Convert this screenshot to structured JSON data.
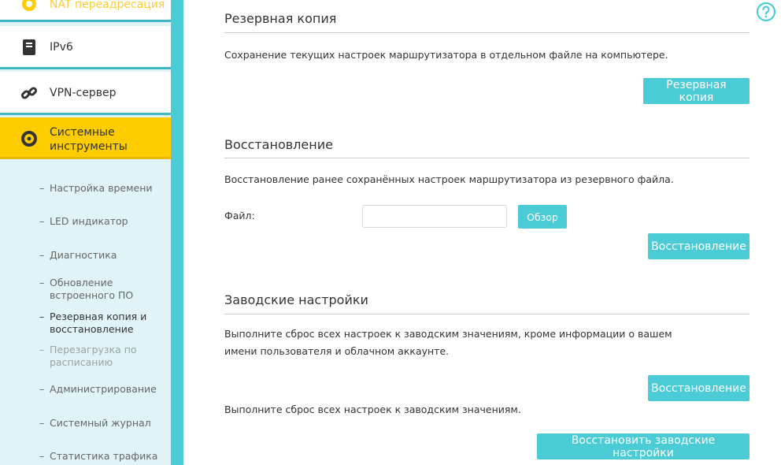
{
  "sidebar": {
    "items": [
      {
        "label": "NAT переадресация",
        "icon": "nat-icon"
      },
      {
        "label": "IPv6",
        "icon": "ipv6-icon"
      },
      {
        "label": "VPN-сервер",
        "icon": "link-icon"
      },
      {
        "label": "Системные\nинструменты",
        "icon": "gear-icon"
      }
    ],
    "sub_items": [
      "Настройка времени",
      "LED индикатор",
      "Диагностика",
      "Обновление\nвстроенного ПО",
      "Резервная копия и\nвосстановление",
      "Перезагрузка по\nрасписанию",
      "Администрирование",
      "Системный журнал",
      "Статистика трафика"
    ],
    "dash": "–"
  },
  "backup": {
    "title": "Резервная копия",
    "description": "Сохранение текущих настроек маршрутизатора в отдельном файле на компьютере.",
    "button": "Резервная копия"
  },
  "restore": {
    "title": "Восстановление",
    "description": "Восстановление ранее сохранённых настроек маршрутизатора из резервного файла.",
    "file_label": "Файл:",
    "file_value": "",
    "browse_button": "Обзор",
    "button": "Восстановление"
  },
  "factory": {
    "title": "Заводские настройки",
    "description1": "Выполните сброс всех настроек к заводским значениям, кроме информации о вашем имени пользователя и облачном аккаунте.",
    "button1": "Восстановление",
    "description2": "Выполните сброс всех настроек к заводским значениям.",
    "button2": "Восстановить заводские настройки"
  },
  "colors": {
    "accent": "#4acbd6",
    "active": "#ffcc00",
    "sidebar_bg": "#e0f3f6"
  }
}
